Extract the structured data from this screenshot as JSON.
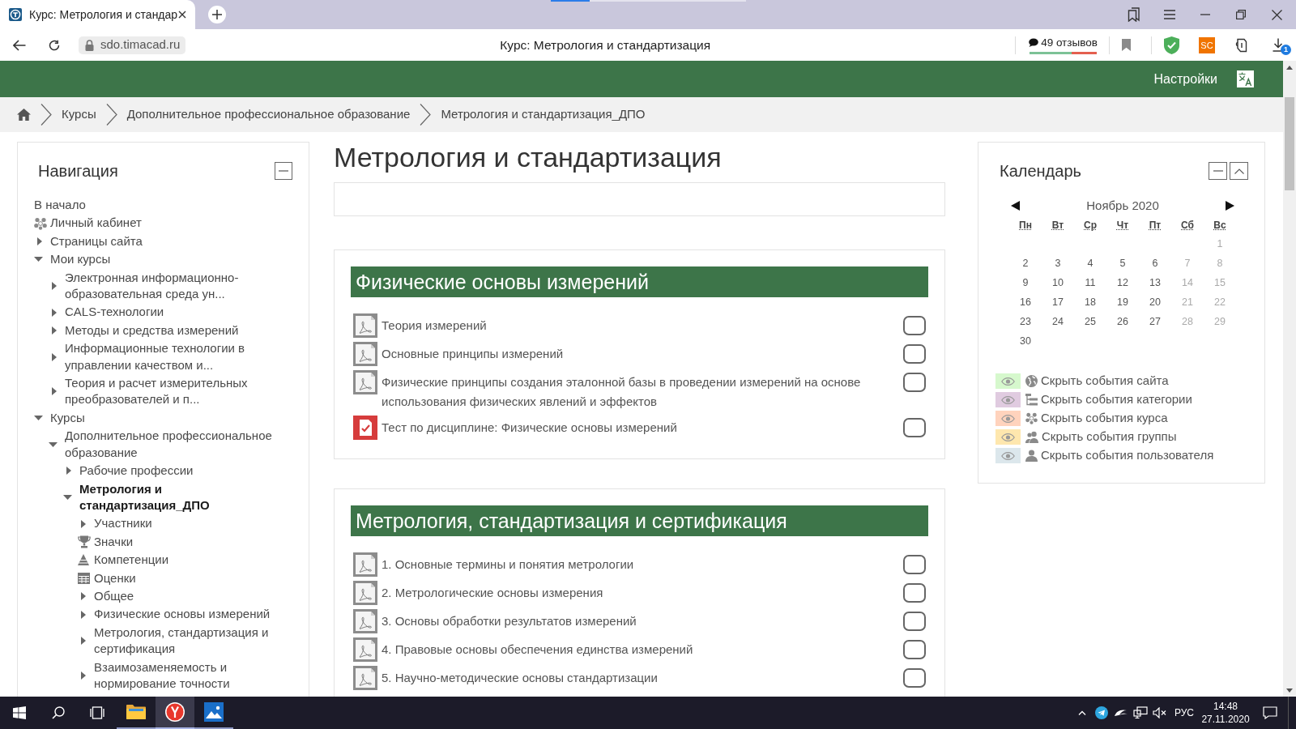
{
  "browser": {
    "tab_title": "Курс: Метрология и стандар",
    "address": "sdo.timacad.ru",
    "page_title": "Курс: Метрология и стандартизация",
    "reviews": "49 отзывов",
    "extension_label": "SC",
    "downloads_badge": "1"
  },
  "header": {
    "settings": "Настройки"
  },
  "breadcrumb": [
    "Курсы",
    "Дополнительное профессиональное образование",
    "Метрология и стандартизация_ДПО"
  ],
  "navigation": {
    "title": "Навигация",
    "items": [
      {
        "kind": "link",
        "label": "В начало",
        "current": false
      },
      {
        "kind": "dashboard",
        "label": "Личный кабинет",
        "current": false
      },
      {
        "kind": "branch",
        "label": "Страницы сайта",
        "expanded": false,
        "current": false
      },
      {
        "kind": "branch",
        "label": "Мои курсы",
        "expanded": true,
        "current": false,
        "children": [
          {
            "kind": "branch",
            "label": "Электронная информационно-образовательная среда ун...",
            "expanded": false,
            "current": false
          },
          {
            "kind": "branch",
            "label": "CALS-технологии",
            "expanded": false,
            "current": false
          },
          {
            "kind": "branch",
            "label": "Методы и средства измерений",
            "expanded": false,
            "current": false
          },
          {
            "kind": "branch",
            "label": "Информационные технологии в управлении качеством и...",
            "expanded": false,
            "current": false
          },
          {
            "kind": "branch",
            "label": "Теория и расчет измерительных преобразователей и п...",
            "expanded": false,
            "current": false
          }
        ]
      },
      {
        "kind": "branch",
        "label": "Курсы",
        "expanded": true,
        "current": false,
        "children": [
          {
            "kind": "branch",
            "label": "Дополнительное профессиональное образование",
            "expanded": true,
            "current": false,
            "children": [
              {
                "kind": "branch",
                "label": "Рабочие профессии",
                "expanded": false,
                "current": false
              },
              {
                "kind": "branch",
                "label": "Метрология и стандартизация_ДПО",
                "expanded": true,
                "current": true,
                "children": [
                  {
                    "kind": "branch",
                    "label": "Участники",
                    "expanded": false,
                    "current": false
                  },
                  {
                    "kind": "badges",
                    "label": "Значки",
                    "current": false
                  },
                  {
                    "kind": "competencies",
                    "label": "Компетенции",
                    "current": false
                  },
                  {
                    "kind": "grades",
                    "label": "Оценки",
                    "current": false
                  },
                  {
                    "kind": "branch",
                    "label": "Общее",
                    "expanded": false,
                    "current": false
                  },
                  {
                    "kind": "branch",
                    "label": "Физические основы измерений",
                    "expanded": false,
                    "current": false
                  },
                  {
                    "kind": "branch",
                    "label": "Метрология, стандартизация и сертификация",
                    "expanded": false,
                    "current": false
                  },
                  {
                    "kind": "branch",
                    "label": "Взаимозаменяемость и нормирование точности",
                    "expanded": false,
                    "current": false
                  }
                ]
              }
            ]
          }
        ]
      }
    ]
  },
  "course": {
    "title": "Метрология и стандартизация",
    "sections": [
      {
        "title": "Физические основы измерений",
        "activities": [
          {
            "kind": "pdf",
            "name": "Теория измерений",
            "checked": false
          },
          {
            "kind": "pdf",
            "name": "Основные принципы измерений",
            "checked": false
          },
          {
            "kind": "pdf",
            "name": "Физические принципы создания эталонной базы в проведении измерений на основе использования физических явлений и эффектов",
            "checked": false
          },
          {
            "kind": "quiz",
            "name": "Тест по дисциплине: Физические основы измерений",
            "checked": false
          }
        ]
      },
      {
        "title": "Метрология, стандартизация и сертификация",
        "activities": [
          {
            "kind": "pdf",
            "name": "1. Основные термины и понятия метрологии",
            "checked": false
          },
          {
            "kind": "pdf",
            "name": "2. Метрологические основы измерения",
            "checked": false
          },
          {
            "kind": "pdf",
            "name": "3. Основы обработки результатов измерений",
            "checked": false
          },
          {
            "kind": "pdf",
            "name": "4. Правовые основы обеспечения единства измерений",
            "checked": false
          },
          {
            "kind": "pdf",
            "name": "5. Научно-методические основы стандартизации",
            "checked": false
          }
        ]
      }
    ]
  },
  "calendar": {
    "title": "Календарь",
    "month": "Ноябрь 2020",
    "weekdays": [
      "Пн",
      "Вт",
      "Ср",
      "Чт",
      "Пт",
      "Сб",
      "Вс"
    ],
    "weeks": [
      {
        "kind": "first",
        "days": [
          {
            "day": "1",
            "weekend": true
          }
        ]
      },
      {
        "kind": "full",
        "days": [
          {
            "day": "2",
            "weekend": false
          },
          {
            "day": "3",
            "weekend": false
          },
          {
            "day": "4",
            "weekend": false
          },
          {
            "day": "5",
            "weekend": false
          },
          {
            "day": "6",
            "weekend": false
          },
          {
            "day": "7",
            "weekend": true
          },
          {
            "day": "8",
            "weekend": true
          }
        ]
      },
      {
        "kind": "full",
        "days": [
          {
            "day": "9",
            "weekend": false
          },
          {
            "day": "10",
            "weekend": false
          },
          {
            "day": "11",
            "weekend": false
          },
          {
            "day": "12",
            "weekend": false
          },
          {
            "day": "13",
            "weekend": false
          },
          {
            "day": "14",
            "weekend": true
          },
          {
            "day": "15",
            "weekend": true
          }
        ]
      },
      {
        "kind": "full",
        "days": [
          {
            "day": "16",
            "weekend": false
          },
          {
            "day": "17",
            "weekend": false
          },
          {
            "day": "18",
            "weekend": false
          },
          {
            "day": "19",
            "weekend": false
          },
          {
            "day": "20",
            "weekend": false
          },
          {
            "day": "21",
            "weekend": true
          },
          {
            "day": "22",
            "weekend": true
          }
        ]
      },
      {
        "kind": "full",
        "days": [
          {
            "day": "23",
            "weekend": false
          },
          {
            "day": "24",
            "weekend": false
          },
          {
            "day": "25",
            "weekend": false
          },
          {
            "day": "26",
            "weekend": false
          },
          {
            "day": "27",
            "weekend": false
          },
          {
            "day": "28",
            "weekend": true
          },
          {
            "day": "29",
            "weekend": true
          }
        ]
      },
      {
        "kind": "last",
        "days": [
          {
            "day": "30",
            "weekend": false
          }
        ]
      }
    ],
    "filters": [
      {
        "kind": "site",
        "label": "Скрыть события сайта",
        "color": "#d6f8cd"
      },
      {
        "kind": "category",
        "label": "Скрыть события категории",
        "color": "#e0cbe0"
      },
      {
        "kind": "course",
        "label": "Скрыть события курса",
        "color": "#ffd3bd"
      },
      {
        "kind": "group",
        "label": "Скрыть события группы",
        "color": "#fee7ae"
      },
      {
        "kind": "user",
        "label": "Скрыть события пользователя",
        "color": "#dce7ec"
      }
    ]
  },
  "taskbar": {
    "apps": [
      {
        "kind": "files",
        "selected": false
      },
      {
        "kind": "browser",
        "selected": true
      },
      {
        "kind": "photos",
        "selected": false
      }
    ],
    "language": "РУС",
    "time": "14:48",
    "date": "27.11.2020"
  }
}
